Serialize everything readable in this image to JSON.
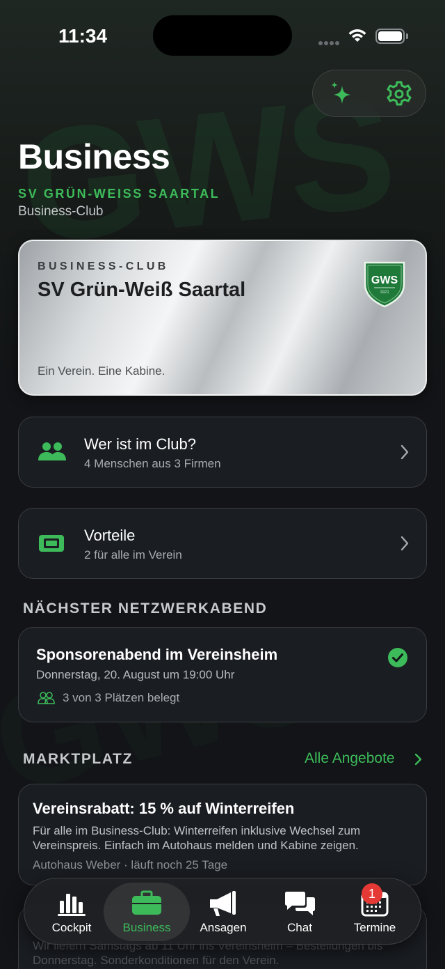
{
  "status_bar": {
    "time": "11:34"
  },
  "header": {
    "title": "Business",
    "club_name": "SV GRÜN-WEISS SAARTAL",
    "subtitle": "Business-Club",
    "buttons": {
      "sparkle_icon": "sparkle-icon",
      "settings_icon": "gear-icon"
    }
  },
  "membership_card": {
    "label": "BUSINESS-CLUB",
    "club": "SV Grün-Weiß Saartal",
    "slogan": "Ein Verein. Eine Kabine.",
    "crest_text": "GWS",
    "crest_year": "1921"
  },
  "rows": [
    {
      "title": "Wer ist im Club?",
      "subtitle": "4 Menschen aus 3 Firmen",
      "icon": "people-icon"
    },
    {
      "title": "Vorteile",
      "subtitle": "2 für alle im Verein",
      "icon": "ticket-icon"
    }
  ],
  "next_event": {
    "section_title": "NÄCHSTER NETZWERKABEND",
    "title": "Sponsorenabend im Vereinsheim",
    "date": "Donnerstag, 20. August um 19:00 Uhr",
    "seats": "3 von 3 Plätzen belegt",
    "status_icon": "check-circle-icon"
  },
  "marketplace": {
    "section_title": "MARKTPLATZ",
    "all_offers": "Alle Angebote",
    "offers": [
      {
        "title": "Vereinsrabatt: 15 % auf Winterreifen",
        "description": "Für alle im Business-Club: Winterreifen inklusive Wechsel zum Vereinspreis. Einfach im Autohaus melden und Kabine zeigen.",
        "meta": "Autohaus Weber · läuft noch 25 Tage"
      },
      {
        "description": "Wir liefern Samstags ab 11 Uhr ins Vereinsheim – Bestellungen bis Donnerstag. Sonderkonditionen für den Verein."
      }
    ]
  },
  "tabbar": {
    "tabs": [
      {
        "label": "Cockpit",
        "icon": "bar-chart-icon"
      },
      {
        "label": "Business",
        "icon": "briefcase-icon"
      },
      {
        "label": "Ansagen",
        "icon": "megaphone-icon"
      },
      {
        "label": "Chat",
        "icon": "chat-bubbles-icon"
      },
      {
        "label": "Termine",
        "icon": "calendar-icon"
      }
    ],
    "active": "Business",
    "termine_badge": "1"
  },
  "colors": {
    "accent": "#3dbb5a",
    "background": "#121417",
    "card": "#1a1d22",
    "badge": "#e53935"
  }
}
